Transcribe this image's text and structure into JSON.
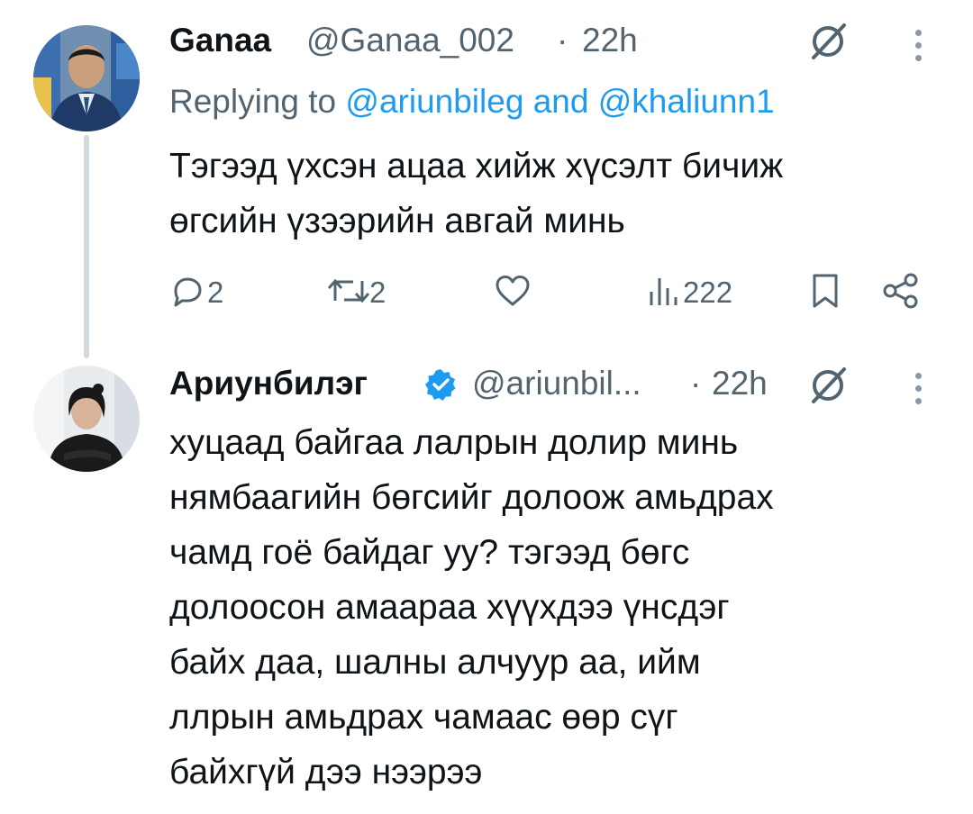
{
  "reply": {
    "author": "Ganaa",
    "handle": "@Ganaa_002",
    "dot": "·",
    "time": "22h",
    "replying_prefix": "Replying to",
    "reply_to_1": "@ariunbileg",
    "and_word": "and",
    "reply_to_2": "@khaliunn1",
    "text_line1": "Тэгээд үхсэн ацаа хийж хүсэлт бичиж",
    "text_line2": "өгсийн үзээрийн авгай минь",
    "actions": {
      "replies": "2",
      "reposts": "2",
      "likes": "",
      "views": "222"
    }
  },
  "main_post": {
    "author": "Ариунбилэг",
    "handle": "@ariunbil...",
    "dot": "·",
    "time": "22h",
    "lines": [
      "хуцаад байгаа лалрын долир минь",
      "нямбаагийн бөгсийг долоож амьдрах",
      "чамд гоё байдаг уу? тэгээд бөгс",
      "долоосон амаараа хүүхдээ үнсдэг",
      "байх даа, шалны алчуур аа, ийм",
      "ллрын амьдрах чамаас өөр сүг",
      "байхгүй дээ нээрээ"
    ]
  },
  "colors": {
    "accent": "#1d9bf0",
    "secondary_text": "#536471",
    "thread_line": "#cfd9de"
  },
  "icons": [
    "grok-icon",
    "more-icon",
    "reply-icon",
    "repost-icon",
    "like-icon",
    "views-icon",
    "bookmark-icon",
    "share-icon",
    "verified-badge-icon"
  ]
}
